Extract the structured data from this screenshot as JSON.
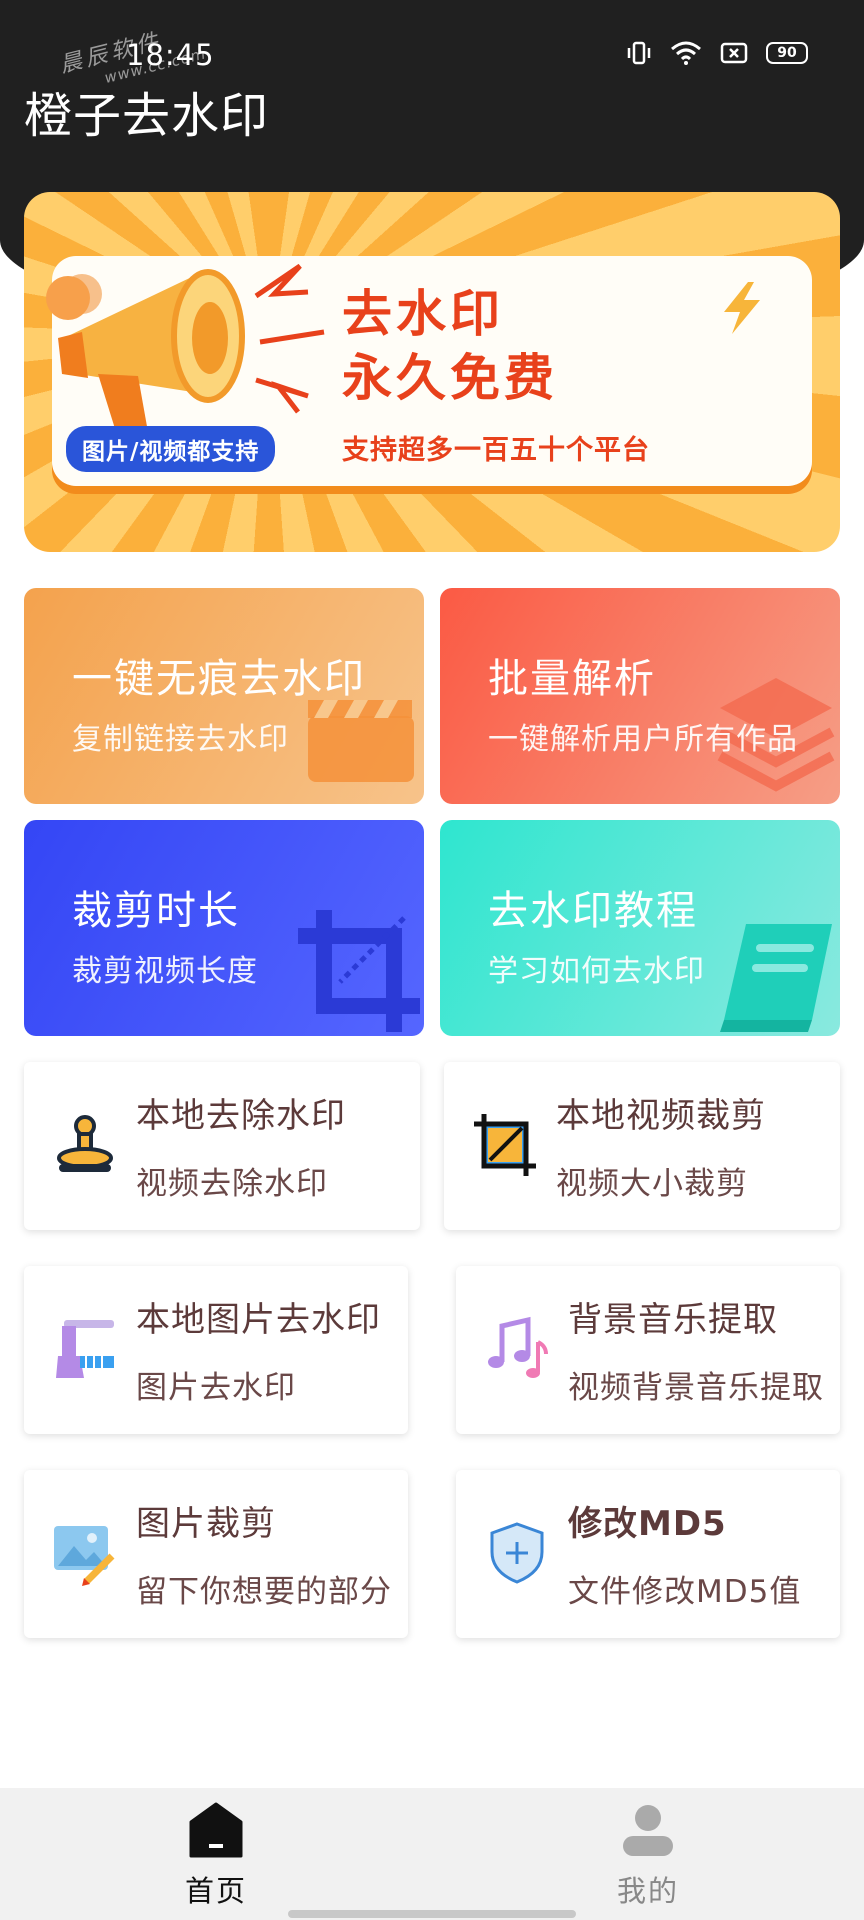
{
  "status_bar": {
    "time": "18:45",
    "watermark_text": "晨辰软件",
    "watermark_url": "www.cc.com",
    "battery": "90"
  },
  "app": {
    "title": "橙子去水印"
  },
  "banner": {
    "headline_line1": "去水印",
    "headline_line2": "永久免费",
    "pill": "图片/视频都支持",
    "subline": "支持超多一百五十个平台"
  },
  "tiles": [
    {
      "title": "一键无痕去水印",
      "subtitle": "复制链接去水印",
      "icon": "clapperboard-icon"
    },
    {
      "title": "批量解析",
      "subtitle": "一键解析用户所有作品",
      "icon": "layers-icon"
    },
    {
      "title": "裁剪时长",
      "subtitle": "裁剪视频长度",
      "icon": "crop-icon"
    },
    {
      "title": "去水印教程",
      "subtitle": "学习如何去水印",
      "icon": "book-icon"
    }
  ],
  "features": [
    {
      "title": "本地去除水印",
      "subtitle": "视频去除水印",
      "icon": "stamp-icon"
    },
    {
      "title": "本地视频裁剪",
      "subtitle": "视频大小裁剪",
      "icon": "crop-frame-icon"
    },
    {
      "title": "本地图片去水印",
      "subtitle": "图片去水印",
      "icon": "paint-roller-icon"
    },
    {
      "title": "背景音乐提取",
      "subtitle": "视频背景音乐提取",
      "icon": "music-notes-icon"
    },
    {
      "title": "图片裁剪",
      "subtitle": "留下你想要的部分",
      "icon": "image-edit-icon"
    },
    {
      "title": "修改MD5",
      "subtitle": "文件修改MD5值",
      "icon": "shield-plus-icon"
    }
  ],
  "bottom_nav": [
    {
      "label": "首页",
      "icon": "home-icon",
      "active": true
    },
    {
      "label": "我的",
      "icon": "user-icon",
      "active": false
    }
  ],
  "colors": {
    "header": "#202020",
    "banner_orange": "#fbb03b",
    "banner_red": "#e8411b",
    "tile_orange": "#f4a24d",
    "tile_red": "#fb5a44",
    "tile_blue": "#3446f5",
    "tile_teal": "#2ee6cf",
    "card_text": "#5c3a3a"
  }
}
